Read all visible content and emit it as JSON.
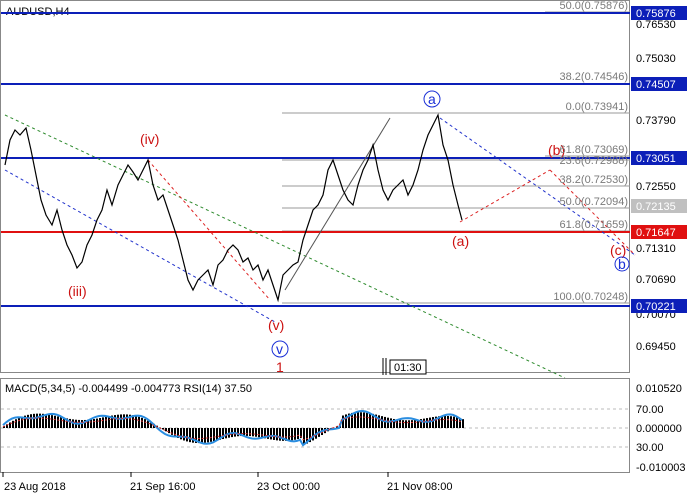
{
  "header": {
    "symbol_label": "AUDUSD,H4"
  },
  "price_axis": {
    "ticks": [
      "0.76530",
      "0.75030",
      "0.73790",
      "0.72550",
      "0.71310",
      "0.70690",
      "0.70070",
      "0.69450"
    ],
    "blue_tags": [
      "0.75876",
      "0.74507",
      "0.73051",
      "0.70221"
    ],
    "red_tags": [
      "0.71647"
    ],
    "grey_tag": "0.72135"
  },
  "fib_levels": [
    {
      "label": "50.0(0.75876)"
    },
    {
      "label": "38.2(0.74546)"
    },
    {
      "label": "0.0(0.73941)"
    },
    {
      "label": "61.8(0.73069)"
    },
    {
      "label": "23.6(0.72988)"
    },
    {
      "label": "38.2(0.72530)"
    },
    {
      "label": "50.0(0.72094)"
    },
    {
      "label": "61.8(0.71659)"
    },
    {
      "label": "100.0(0.70248)"
    }
  ],
  "wave_labels": {
    "iv": "(iv)",
    "iii": "(iii)",
    "v": "(v)",
    "v_circle": "v",
    "one": "1",
    "a_circle": "a",
    "a_paren": "(a)",
    "b_paren": "(b)",
    "c_paren": "(c)",
    "b_circle": "b"
  },
  "time_marker": "01:30",
  "indicator": {
    "title": "MACD(5,34,5) -0.004499 -0.004773 RSI(14) 37.50",
    "axis_ticks": [
      "0.010520",
      "70.00",
      "0.000000",
      "30.00",
      "-0.010003"
    ]
  },
  "date_axis": {
    "labels": [
      "23 Aug 2018",
      "21 Sep 16:00",
      "23 Oct 00:00",
      "21 Nov 08:00"
    ]
  },
  "colors": {
    "price_line": "#000000",
    "blue_level": "#0c1fb8",
    "red_level": "#e01010",
    "fib_line": "#9a9a9a",
    "macd_hist": "#000000",
    "rsi_line": "#2a8de0",
    "signal": "#d83030"
  }
}
